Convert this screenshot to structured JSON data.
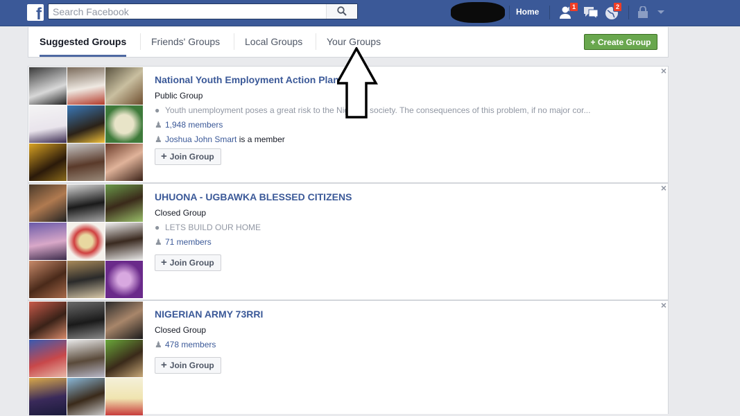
{
  "topbar": {
    "logo_letter": "f",
    "search_placeholder": "Search Facebook",
    "home_label": "Home",
    "friend_requests_badge": "1",
    "notifications_badge": "2"
  },
  "tabs": {
    "suggested": "Suggested Groups",
    "friends": "Friends' Groups",
    "local": "Local Groups",
    "yours": "Your Groups",
    "create": "+ Create Group"
  },
  "groups": [
    {
      "name": "National Youth Employment Action Plan",
      "type": "Public Group",
      "description": "Youth unemployment poses a great risk to the Nigerian society. The consequences of this problem, if no major cor...",
      "members": "1,948 members",
      "member_friend": "Joshua John Smart",
      "member_suffix": " is a member",
      "join_label": "Join Group",
      "close": "×"
    },
    {
      "name": "UHUONA - UGBAWKA BLESSED CITIZENS",
      "type": "Closed Group",
      "description": "LETS BUILD OUR HOME",
      "members": "71 members",
      "join_label": "Join Group",
      "close": "×"
    },
    {
      "name": "NIGERIAN ARMY 73RRI",
      "type": "Closed Group",
      "members": "478 members",
      "join_label": "Join Group",
      "close": "×"
    }
  ],
  "colors": {
    "brand_blue": "#3b5998",
    "create_green": "#69a74e",
    "badge_red": "#f03d25"
  }
}
